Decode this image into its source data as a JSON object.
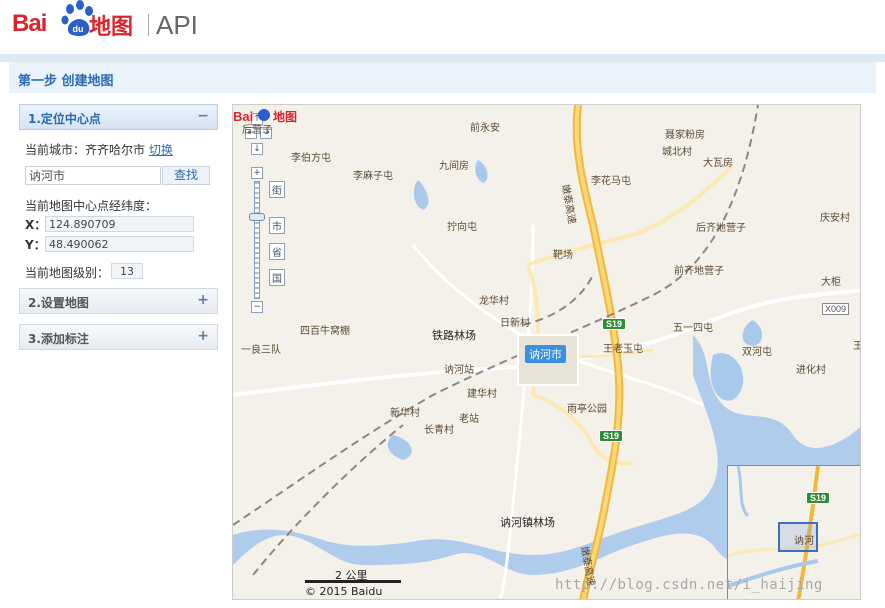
{
  "logo": {
    "bai": "Bai",
    "du": "du",
    "ditu": "地图",
    "api": "API"
  },
  "step": {
    "title": "第一步 创建地图"
  },
  "panel": {
    "sections": [
      {
        "label": "1.定位中心点",
        "toggle": "−"
      },
      {
        "label": "2.设置地图",
        "toggle": "+"
      },
      {
        "label": "3.添加标注",
        "toggle": "+"
      }
    ],
    "current_city_label": "当前城市：齐齐哈尔市",
    "switch_link": "切换",
    "search_value": "讷河市",
    "search_button": "查找",
    "center_label": "当前地图中心点经纬度：",
    "x_label": "X：",
    "x_value": "124.890709",
    "y_label": "Y：",
    "y_value": "48.490062",
    "zoom_label": "当前地图级别：",
    "zoom_value": "13"
  },
  "map": {
    "zoom_tags": [
      "街",
      "市",
      "省",
      "国"
    ],
    "zoom_buttons": {
      "up": "↑",
      "left": "←",
      "right": "→",
      "down": "↓",
      "in": "+",
      "out": "−"
    },
    "labels": {
      "a": "前永安",
      "b": "聂家粉房",
      "c": "城北村",
      "d": "大瓦房",
      "e": "李伯方屯",
      "f": "九间房",
      "g": "李麻子屯",
      "h": "李花马屯",
      "i": "庆安村",
      "j": "拧向屯",
      "k": "后齐地营子",
      "l": "靶场",
      "m": "前齐地营子",
      "n": "大柜",
      "o": "龙华村",
      "p": "日新村",
      "q": "五一四屯",
      "r": "四百牛窝棚",
      "s": "铁路林场",
      "t": "王老玉屯",
      "u": "一良三队",
      "v": "双河屯",
      "w": "讷河站",
      "x": "进化村",
      "y": "建华村",
      "z": "雨亭公园",
      "aa": "新华村",
      "ab": "老站",
      "ac": "长青村",
      "ad": "讷河镇林场",
      "ae": "嫩泰高速",
      "af": "嫩泰高速",
      "ag": "后营子",
      "ah": "王"
    },
    "city_badge": "讷河市",
    "shield_1": "S19",
    "shield_2": "S19",
    "shield_x": "X009",
    "scale": "2 公里",
    "copyright": "© 2015 Baidu",
    "overview_shield": "S19",
    "overview_label": "讷河"
  },
  "watermark": "http://blog.csdn.net/i_haijing"
}
